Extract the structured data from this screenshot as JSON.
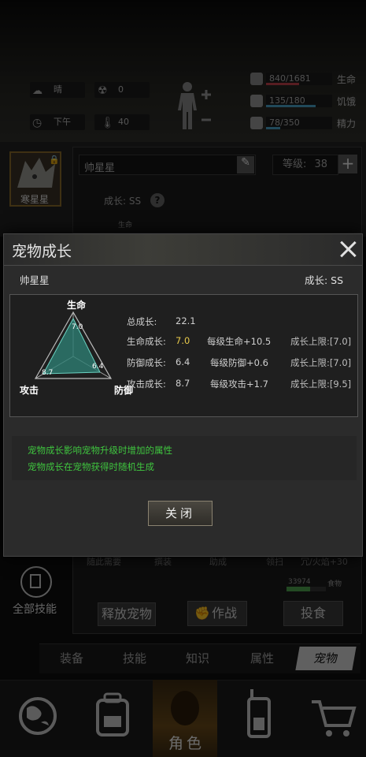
{
  "status": {
    "weather": "晴",
    "radiation": "0",
    "time_of_day": "下午",
    "temperature": "40",
    "health": {
      "text": "840/1681",
      "label": "生命",
      "fraction": 0.5,
      "color": "#c2414b"
    },
    "hunger": {
      "text": "135/180",
      "label": "饥饿",
      "fraction": 0.75,
      "color": "#4aa3c7"
    },
    "energy": {
      "text": "78/350",
      "label": "精力",
      "fraction": 0.22,
      "color": "#4aa3c7"
    }
  },
  "pet_panel": {
    "avatar_name": "寒星星",
    "name_field": "帅星星",
    "level_label": "等级:",
    "level": "38",
    "growth_label": "成长: SS",
    "under_text": "生命"
  },
  "dialog": {
    "title": "宠物成长",
    "pet_name": "帅星星",
    "growth_grade": "成长: SS",
    "radar": {
      "axis_top": "生命",
      "axis_left": "攻击",
      "axis_right": "防御",
      "val_life": "7.0",
      "val_attack": "8.7",
      "val_defense": "6.4"
    },
    "total_label": "总成长:",
    "total_value": "22.1",
    "rows": [
      {
        "label": "生命成长:",
        "value": "7.0",
        "per_level": "每级生命+10.5",
        "cap": "成长上限:[7.0]"
      },
      {
        "label": "防御成长:",
        "value": "6.4",
        "per_level": "每级防御+0.6",
        "cap": "成长上限:[7.0]"
      },
      {
        "label": "攻击成长:",
        "value": "8.7",
        "per_level": "每级攻击+1.7",
        "cap": "成长上限:[9.5]"
      }
    ],
    "desc1": "宠物成长影响宠物升级时增加的属性",
    "desc2": "宠物成长在宠物获得时随机生成",
    "close_button": "关闭"
  },
  "lower_panel": {
    "partial_row": [
      "随此需要",
      "撰装",
      "助成",
      "领扫",
      "冗/火焰+30"
    ],
    "food_count": "33974",
    "food_label": "食物",
    "all_skills": "全部技能",
    "release_pet": "释放宠物",
    "battle": "作战",
    "feed": "投食"
  },
  "tabs": [
    "装备",
    "技能",
    "知识",
    "属性",
    "宠物"
  ],
  "nav": {
    "active_label": "角色"
  },
  "colors": {
    "green_text": "#3fc53f",
    "highlight_value": "#e7c94a"
  }
}
